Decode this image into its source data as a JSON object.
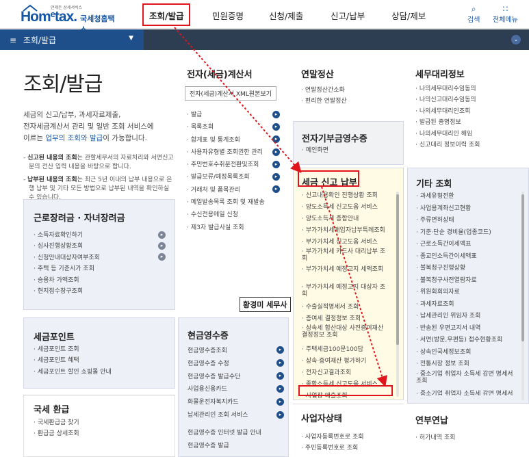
{
  "header": {
    "logo_small": "언제든 상세서비스",
    "logo_home": "Hom",
    "logo_tax": "tax.",
    "logo_e": "e",
    "logo_kor": "국세청홈택스",
    "nav": [
      "조회/발급",
      "민원증명",
      "신청/제출",
      "신고/납부",
      "상담/제보"
    ],
    "search": "검색",
    "all_menu": "전체메뉴"
  },
  "subbar": {
    "selected": "조회/발급"
  },
  "intro": {
    "title": "조회/발급",
    "text_1": "세금의 신고/납부, 과세자료제출,",
    "text_2": "전자세금계산서 관리 및 일반 조회 서비스에",
    "text_3_prefix": "이르는 ",
    "text_3_link": "업무의 조회와 발급",
    "text_3_suffix": "이 가능합니다.",
    "note_1_bold": "신고된 내용의 조회",
    "note_1_pre": "- ",
    "note_1_rest": "는 관할세무서의 자료처리와 서면신고분의 전산 입력 내용을 바탕으로 합니다.",
    "note_2_pre": "- ",
    "note_2_bold": "납부된 내용의 조회",
    "note_2_rest": "는 최근 5년 이내의 납부 내용으로 은행 납부 및 기타 모든 방법으로 납부된 내역을 확인하실 수 있습니다."
  },
  "panels": {
    "earned_income": {
      "title": "근로장려금 · 자녀장려금",
      "items": [
        "소득자료확인하기",
        "심사진행상황조회",
        "신청안내대상자여부조회",
        "주택 등 기준시가 조회",
        "승용차 가액조회",
        "현지접수창구조회"
      ]
    },
    "tax_point": {
      "title": "세금포인트",
      "items": [
        "세금포인트 조회",
        "세금포인트 혜택",
        "세금포인트 할인 쇼핑몰 안내"
      ]
    },
    "refund": {
      "title": "국세 환급",
      "items": [
        "국세환급금 찾기",
        "환급금 상세조회"
      ]
    },
    "e_invoice": {
      "title": "전자(세금)계산서",
      "button": "전자(세금)계산서 XML원본보기",
      "items": [
        "발급",
        "목록조회",
        "합계표 및 통계조회",
        "사용자유형별 조회권한 관리",
        "주민번호수취분전환및조회",
        "발급보류/예정목록조회",
        "거래처 및 품목관리",
        "메일발송목록 조회 및 재발송",
        "수신전용메일 신청",
        "제3자 발급사실 조회"
      ]
    },
    "cash_receipt": {
      "title": "현금영수증",
      "items": [
        "현금영수증조회",
        "현금영수증 수정",
        "현금영수증 발급수단",
        "사업용신용카드",
        "화물운전자복지카드",
        "납세관리인 조회 서비스",
        "현금영수증 인터넷 발급 안내",
        "현금영수증 발급"
      ]
    },
    "year_end": {
      "title": "연말정산",
      "items": [
        "연말정산간소화",
        "편리한 연말정산"
      ]
    },
    "donation": {
      "title": "전자기부금영수증",
      "items": [
        "메인화면"
      ]
    },
    "tax_report": {
      "title": "세금 신고 납부",
      "items": [
        "신고내용확인 진행상황 조회",
        "양도소득세 신고도움 서비스",
        "양도소득세 종합안내",
        "부가가치세매입자납부특례조회",
        "부가가치세 신고도움 서비스",
        "부가가치세 카드사 대리납부 조회",
        "부가가치세 예정고지 세액조회",
        "부가가치세 예정고지 대상자 조회",
        "수출실적명세서 조회",
        "증여세 결정정보 조회",
        "상속세 합산대상 사전증여재산 결정정보 조회",
        "주택세금100문100답",
        "상속·증여재산 평가하기",
        "전자신고결과조회",
        "종합소득세 신고도움 서비스",
        "사업장 매출조회"
      ]
    },
    "business": {
      "title": "사업자상태",
      "items": [
        "사업자등록번호로 조회",
        "주민등록번호로 조회"
      ]
    },
    "tax_agent": {
      "title": "세무대리정보",
      "items": [
        "나의세무대리수임동의",
        "나의신고대리수임동의",
        "나의세무대리인조회",
        "발급된 증명정보",
        "나의세무대리인 해임",
        "신고대리 정보이력 조회"
      ]
    },
    "other": {
      "title": "기타 조회",
      "items": [
        "과세유형전환",
        "사업용계좌신고현황",
        "주류면허상태",
        "기준·단순 경비율(업종코드)",
        "근로소득간이세액표",
        "종교인소득간이세액표",
        "불복청구진행상황",
        "불복청구사전열람자료",
        "위원회회의자료",
        "과세자료조회",
        "납세관리인 위임자 조회",
        "반송된 우편고지서 내역",
        "서면(방문,우편등) 접수현황조회",
        "상속인국세정보조회",
        "전통시장 정보 조회",
        "중소기업 취업자 소득세 감면 명세서 조회",
        "중소기업 취업자 소득세 감면 명세서"
      ]
    },
    "pension": {
      "title": "연부연납",
      "items": [
        "허가내역 조회"
      ]
    }
  },
  "annotation": "황경미 세무사",
  "colors": {
    "brand": "#1457a6",
    "highlight_red": "#e1141b",
    "subbar": "#2d3e52",
    "subbar_sel": "#1f4f8b"
  }
}
